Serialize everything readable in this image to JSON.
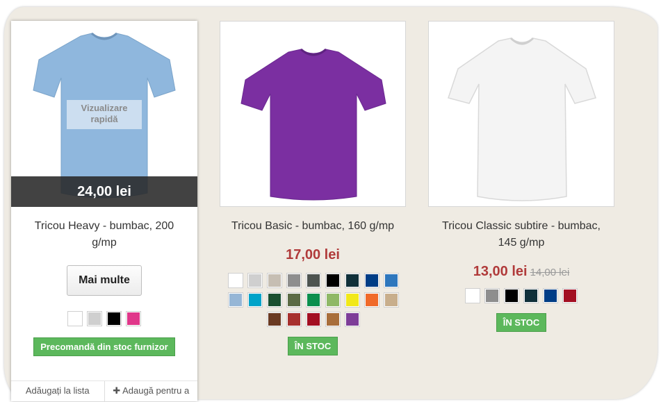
{
  "products": [
    {
      "title": "Tricou Heavy - bumbac, 200 g/mp",
      "price": "24,00 lei",
      "quick_view": "Vizualizare rapidă",
      "more_button": "Mai multe",
      "colors": [
        "#ffffff",
        "#cfcfcf",
        "#000000",
        "#e0378a"
      ],
      "stock_badge": "Precomandă din stoc furnizor",
      "links": [
        "Adăugați la lista",
        "Adaugă pentru a"
      ],
      "shirt_color": "#8fb7dd"
    },
    {
      "title": "Tricou Basic - bumbac, 160 g/mp",
      "price": "17,00 lei",
      "colors": [
        "#ffffff",
        "#cfcfcf",
        "#c6beb3",
        "#8e8e8e",
        "#4d5450",
        "#000000",
        "#10303a",
        "#003d86",
        "#2e77bd",
        "#96b6d6",
        "#00a3c9",
        "#1a4f30",
        "#5c6b45",
        "#0b8f4d",
        "#8fb866",
        "#f1e81a",
        "#f06a2a",
        "#c8ae8c",
        "#6a3a22",
        "#a7302e",
        "#a30f22",
        "#a86e3b",
        "#7d3d98"
      ],
      "stock_badge": "ÎN STOC",
      "shirt_color": "#7b2fa1"
    },
    {
      "title": "Tricou Classic subtire - bumbac, 145 g/mp",
      "price": "13,00 lei",
      "old_price": "14,00 lei",
      "colors": [
        "#ffffff",
        "#8e8e8e",
        "#000000",
        "#10303a",
        "#003d86",
        "#a30f22"
      ],
      "stock_badge": "ÎN STOC",
      "shirt_color": "#f4f4f4"
    }
  ]
}
